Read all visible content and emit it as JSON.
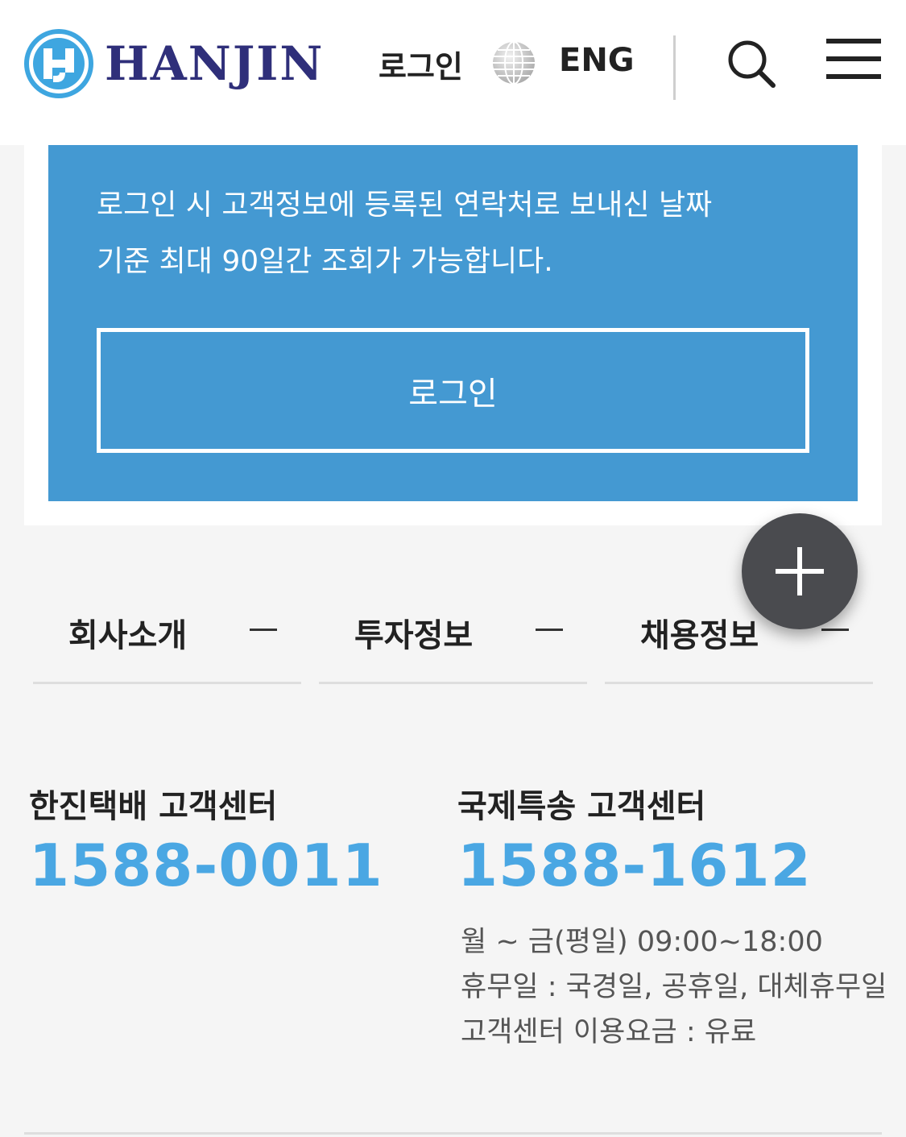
{
  "header": {
    "logo_text": "HANJIN",
    "login_label": "로그인",
    "language_label": "ENG"
  },
  "panel": {
    "line1": "로그인 시 고객정보에 등록된 연락처로 보내신 날짜",
    "line2": "기준 최대 90일간 조회가 가능합니다.",
    "button_label": "로그인"
  },
  "footer_nav": {
    "items": [
      {
        "label": "회사소개"
      },
      {
        "label": "투자정보"
      },
      {
        "label": "채용정보"
      }
    ]
  },
  "customer_centers": {
    "domestic": {
      "title": "한진택배 고객센터",
      "phone": "1588-0011"
    },
    "international": {
      "title": "국제특송 고객센터",
      "phone": "1588-1612"
    }
  },
  "hours": {
    "weekday": "월 ~ 금(평일) 09:00~18:00",
    "closed": "휴무일 : 국경일, 공휴일, 대체휴무일",
    "fee": "고객센터 이용요금 : 유료"
  },
  "colors": {
    "brand_blue": "#4499d2",
    "phone_blue": "#4aa7e3",
    "logo_navy": "#2f2f7a"
  },
  "icons": [
    "hanjin-logo-mark",
    "globe-icon",
    "search-icon",
    "menu-icon",
    "plus-icon",
    "dash-icon"
  ]
}
